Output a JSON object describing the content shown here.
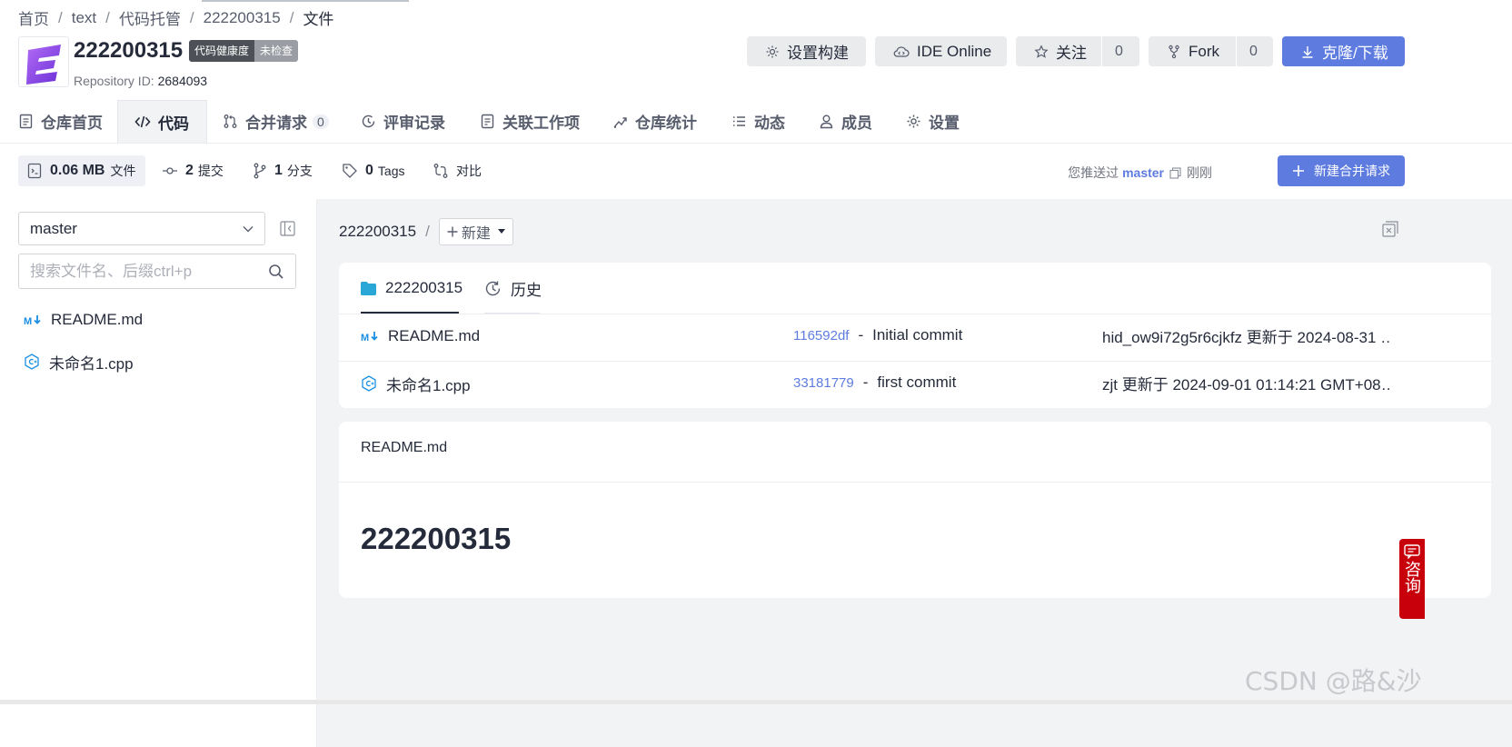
{
  "breadcrumb": [
    "首页",
    "text",
    "代码托管",
    "222200315",
    "文件"
  ],
  "repo": {
    "name": "222200315",
    "health_label": "代码健康度",
    "health_status": "未检查",
    "id_label": "Repository ID:",
    "id_value": "2684093"
  },
  "header_buttons": {
    "settings_build": "设置构建",
    "ide_online": "IDE Online",
    "follow": "关注",
    "follow_count": "0",
    "fork": "Fork",
    "fork_count": "0",
    "clone": "克隆/下载"
  },
  "tabs": [
    {
      "label": "仓库首页",
      "icon": "file-icon"
    },
    {
      "label": "代码",
      "icon": "code-icon"
    },
    {
      "label": "合并请求",
      "icon": "merge-icon",
      "badge": "0"
    },
    {
      "label": "评审记录",
      "icon": "review-icon"
    },
    {
      "label": "关联工作项",
      "icon": "workitem-icon"
    },
    {
      "label": "仓库统计",
      "icon": "stats-icon"
    },
    {
      "label": "动态",
      "icon": "list-icon"
    },
    {
      "label": "成员",
      "icon": "user-icon"
    },
    {
      "label": "设置",
      "icon": "gear-icon"
    }
  ],
  "stats": {
    "size": "0.06 MB",
    "size_label": "文件",
    "commits": "2",
    "commits_label": "提交",
    "branches": "1",
    "branches_label": "分支",
    "tags": "0",
    "tags_label": "Tags",
    "compare_label": "对比"
  },
  "push_info": {
    "prefix": "您推送过",
    "branch": "master",
    "time": "刚刚"
  },
  "new_mr_label": "新建合并请求",
  "sidebar": {
    "branch": "master",
    "search_placeholder": "搜索文件名、后缀ctrl+p",
    "files": [
      {
        "name": "README.md",
        "icon": "markdown-icon"
      },
      {
        "name": "未命名1.cpp",
        "icon": "cpp-icon"
      }
    ]
  },
  "path": {
    "root": "222200315",
    "new_label": "新建"
  },
  "file_tabs": {
    "folder": "222200315",
    "history": "历史"
  },
  "files": [
    {
      "name": "README.md",
      "icon": "markdown-icon",
      "hash": "116592df",
      "message": "Initial commit",
      "meta": "hid_ow9i72g5r6cjkfz 更新于 2024-08-31 …"
    },
    {
      "name": "未命名1.cpp",
      "icon": "cpp-icon",
      "hash": "33181779",
      "message": "first commit",
      "meta": "zjt 更新于 2024-09-01 01:14:21 GMT+08…"
    }
  ],
  "readme": {
    "title": "README.md",
    "heading": "222200315"
  },
  "consult_label": "咨询",
  "watermark": "CSDN @路&沙",
  "colors": {
    "accent": "#5e7ce0",
    "consult": "#c7000b"
  }
}
